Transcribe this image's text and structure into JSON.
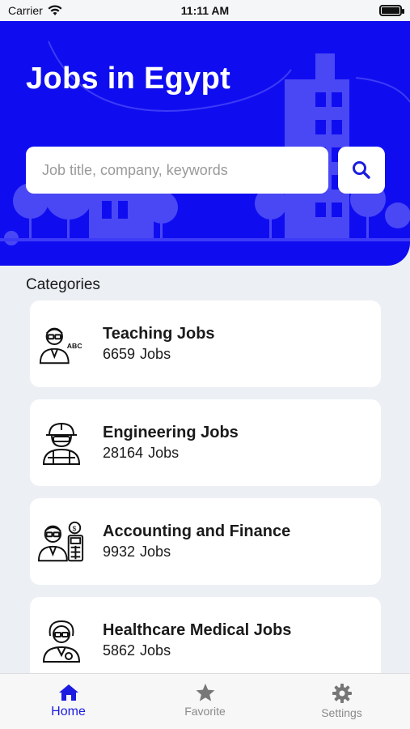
{
  "status_bar": {
    "carrier": "Carrier",
    "time": "11:11 AM"
  },
  "header": {
    "title": "Jobs in Egypt",
    "background_color": "#0F0DF0"
  },
  "search": {
    "placeholder": "Job title, company, keywords",
    "value": ""
  },
  "categories": {
    "title": "Categories",
    "items": [
      {
        "name": "Teaching Jobs",
        "count": "6659",
        "unit": "Jobs",
        "icon": "teacher-icon"
      },
      {
        "name": "Engineering Jobs",
        "count": "28164",
        "unit": "Jobs",
        "icon": "engineer-icon"
      },
      {
        "name": "Accounting and Finance",
        "count": "9932",
        "unit": "Jobs",
        "icon": "accountant-icon"
      },
      {
        "name": "Healthcare Medical Jobs",
        "count": "5862",
        "unit": "Jobs",
        "icon": "doctor-icon"
      }
    ]
  },
  "tab_bar": {
    "active_color": "#1C1CE0",
    "inactive_color": "#8A8A8A",
    "tabs": [
      {
        "label": "Home",
        "icon": "home-icon",
        "active": true
      },
      {
        "label": "Favorite",
        "icon": "star-icon",
        "active": false
      },
      {
        "label": "Settings",
        "icon": "gear-icon",
        "active": false
      }
    ]
  }
}
